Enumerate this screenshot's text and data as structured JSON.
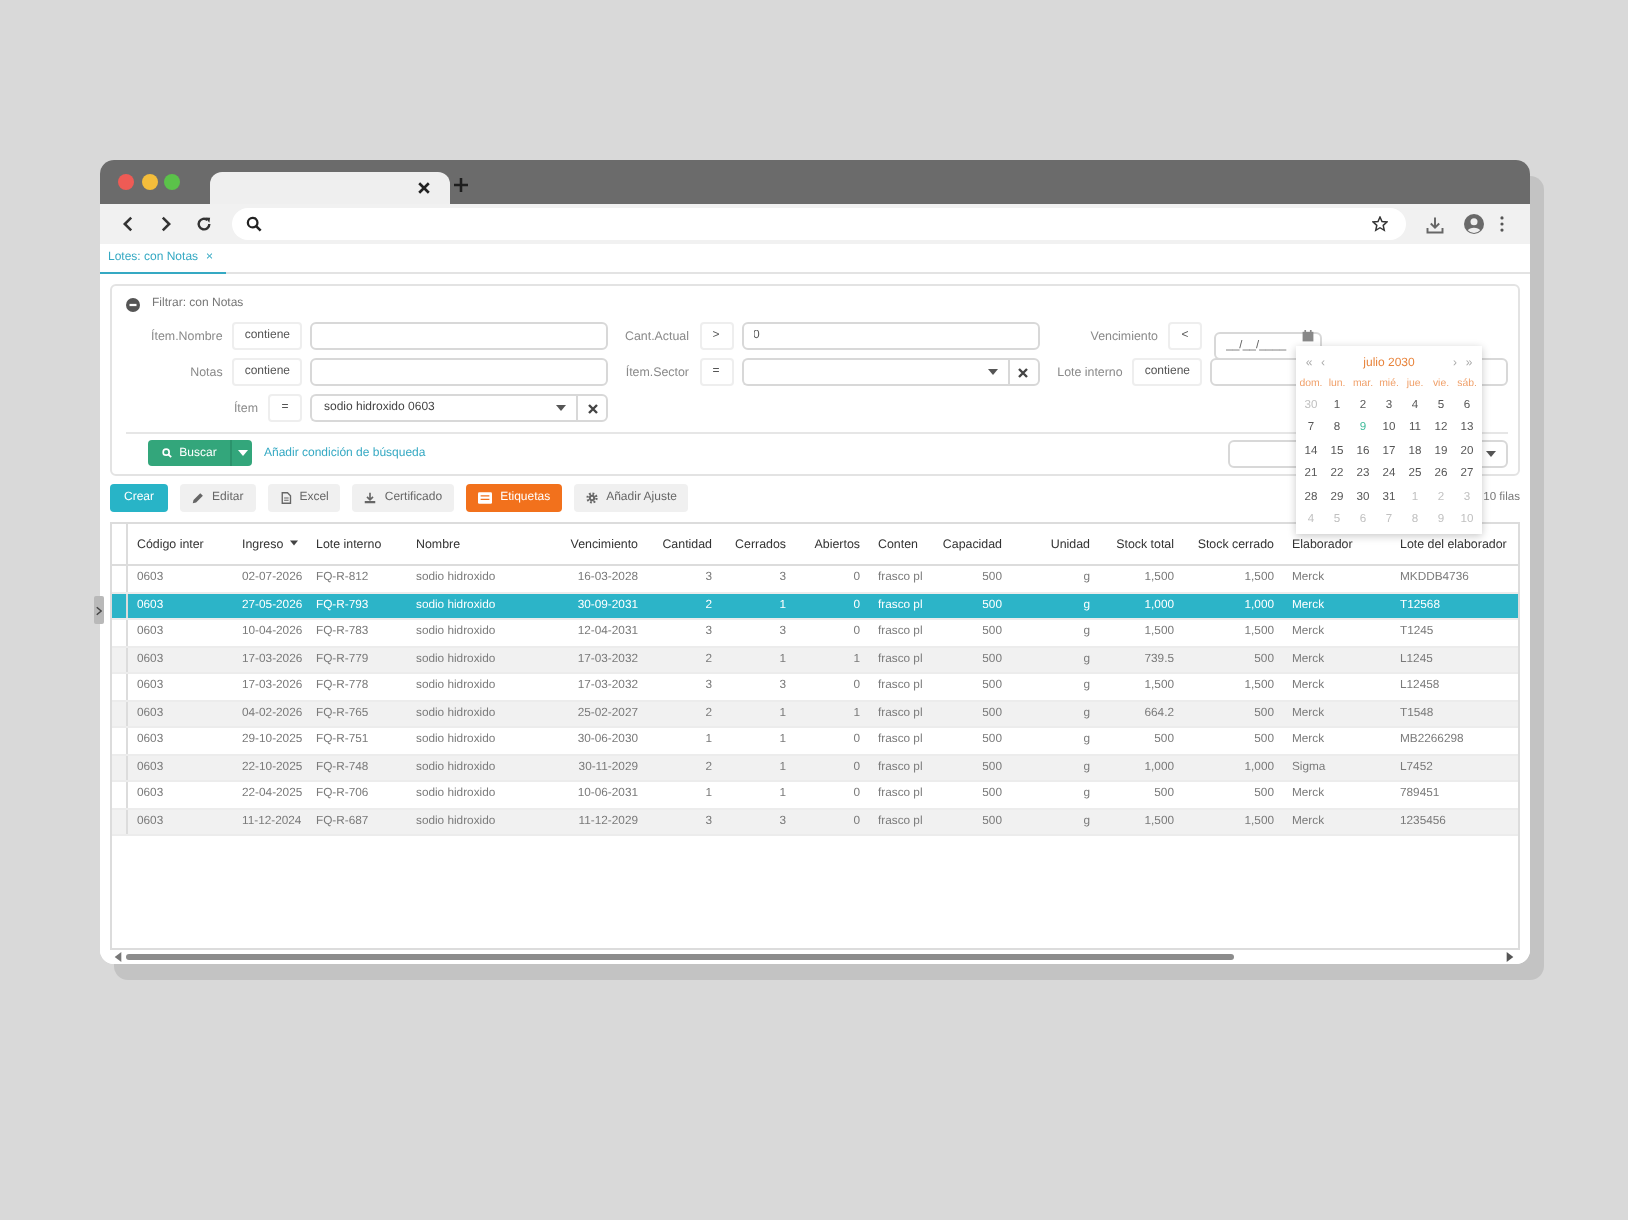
{
  "app_tabs": [
    {
      "label": "Lotes: con Notas",
      "close": "×",
      "selected": true
    }
  ],
  "filter": {
    "title": "Filtrar: con Notas",
    "expanded": true,
    "rows": [
      [
        {
          "label": "Ítem.Nombre",
          "operator": "contiene",
          "kind": "text"
        },
        {
          "label": "Cant.Actual",
          "operator": ">",
          "kind": "text",
          "value": "0"
        },
        {
          "label": "Vencimiento",
          "operator": "<",
          "kind": "date",
          "placeholder": "__/__/____"
        }
      ],
      [
        {
          "label": "Notas",
          "operator": "contiene",
          "kind": "text"
        },
        {
          "label": "Ítem.Sector",
          "operator": "=",
          "kind": "select"
        },
        {
          "label": "Lote interno",
          "operator": "contiene",
          "kind": "text"
        }
      ],
      [
        {
          "label": "Ítem",
          "operator": "=",
          "kind": "select",
          "value": "sodio hidroxido 0603"
        }
      ]
    ],
    "search_button": "Buscar",
    "add_condition": "Añadir condición de búsqueda"
  },
  "actions": {
    "buttons": [
      {
        "label": "Crear",
        "kind": "primary"
      },
      {
        "label": "Editar",
        "kind": "default"
      },
      {
        "label": "Excel",
        "kind": "default"
      },
      {
        "label": "Certificado",
        "kind": "default"
      },
      {
        "label": "Etiquetas",
        "kind": "warning"
      },
      {
        "label": "Añadir Ajuste",
        "kind": "default"
      }
    ],
    "row_count": "10 filas"
  },
  "table": {
    "columns": [
      {
        "label": "Código inter",
        "sorted": false
      },
      {
        "label": "Ingreso",
        "sorted": true
      },
      {
        "label": "Lote interno",
        "sorted": false
      },
      {
        "label": "Nombre",
        "sorted": false
      },
      {
        "label": "Vencimiento",
        "sorted": false
      },
      {
        "label": "Cantidad",
        "sorted": false
      },
      {
        "label": "Cerrados",
        "sorted": false
      },
      {
        "label": "Abiertos",
        "sorted": false
      },
      {
        "label": "Conten",
        "sorted": false
      },
      {
        "label": "Capacidad",
        "sorted": false
      },
      {
        "label": "Unidad",
        "sorted": false
      },
      {
        "label": "Stock total",
        "sorted": false
      },
      {
        "label": "Stock cerrado",
        "sorted": false
      },
      {
        "label": "Elaborador",
        "sorted": false
      },
      {
        "label": "Lote del elaborador",
        "sorted": false
      }
    ],
    "rows": [
      {
        "selected": false,
        "cells": [
          "0603",
          "02-07-2026",
          "FQ-R-812",
          "sodio hidroxido",
          "16-03-2028",
          "3",
          "3",
          "0",
          "frasco pl",
          "500",
          "g",
          "1,500",
          "1,500",
          "Merck",
          "MKDDB4736"
        ]
      },
      {
        "selected": true,
        "cells": [
          "0603",
          "27-05-2026",
          "FQ-R-793",
          "sodio hidroxido",
          "30-09-2031",
          "2",
          "1",
          "0",
          "frasco pl",
          "500",
          "g",
          "1,000",
          "1,000",
          "Merck",
          "T12568"
        ]
      },
      {
        "selected": false,
        "cells": [
          "0603",
          "10-04-2026",
          "FQ-R-783",
          "sodio hidroxido",
          "12-04-2031",
          "3",
          "3",
          "0",
          "frasco pl",
          "500",
          "g",
          "1,500",
          "1,500",
          "Merck",
          "T1245"
        ]
      },
      {
        "selected": false,
        "cells": [
          "0603",
          "17-03-2026",
          "FQ-R-779",
          "sodio hidroxido",
          "17-03-2032",
          "2",
          "1",
          "1",
          "frasco pl",
          "500",
          "g",
          "739.5",
          "500",
          "Merck",
          "L1245"
        ]
      },
      {
        "selected": false,
        "cells": [
          "0603",
          "17-03-2026",
          "FQ-R-778",
          "sodio hidroxido",
          "17-03-2032",
          "3",
          "3",
          "0",
          "frasco pl",
          "500",
          "g",
          "1,500",
          "1,500",
          "Merck",
          "L12458"
        ]
      },
      {
        "selected": false,
        "cells": [
          "0603",
          "04-02-2026",
          "FQ-R-765",
          "sodio hidroxido",
          "25-02-2027",
          "2",
          "1",
          "1",
          "frasco pl",
          "500",
          "g",
          "664.2",
          "500",
          "Merck",
          "T1548"
        ]
      },
      {
        "selected": false,
        "cells": [
          "0603",
          "29-10-2025",
          "FQ-R-751",
          "sodio hidroxido",
          "30-06-2030",
          "1",
          "1",
          "0",
          "frasco pl",
          "500",
          "g",
          "500",
          "500",
          "Merck",
          "MB2266298"
        ]
      },
      {
        "selected": false,
        "cells": [
          "0603",
          "22-10-2025",
          "FQ-R-748",
          "sodio hidroxido",
          "30-11-2029",
          "2",
          "1",
          "0",
          "frasco pl",
          "500",
          "g",
          "1,000",
          "1,000",
          "Sigma",
          "L7452"
        ]
      },
      {
        "selected": false,
        "cells": [
          "0603",
          "22-04-2025",
          "FQ-R-706",
          "sodio hidroxido",
          "10-06-2031",
          "1",
          "1",
          "0",
          "frasco pl",
          "500",
          "g",
          "500",
          "500",
          "Merck",
          "789451"
        ]
      },
      {
        "selected": false,
        "cells": [
          "0603",
          "11-12-2024",
          "FQ-R-687",
          "sodio hidroxido",
          "11-12-2029",
          "3",
          "3",
          "0",
          "frasco pl",
          "500",
          "g",
          "1,500",
          "1,500",
          "Merck",
          "1235456"
        ]
      }
    ]
  },
  "datepicker": {
    "title": "julio 2030",
    "nav": [
      "«",
      "‹",
      "›",
      "»"
    ],
    "weekdays": [
      "dom.",
      "lun.",
      "mar.",
      "mié.",
      "jue.",
      "vie.",
      "sáb."
    ],
    "weeks": [
      [
        {
          "label": "30",
          "kind": "outside"
        },
        {
          "label": "1",
          "kind": "current"
        },
        {
          "label": "2",
          "kind": "current"
        },
        {
          "label": "3",
          "kind": "current"
        },
        {
          "label": "4",
          "kind": "current"
        },
        {
          "label": "5",
          "kind": "current"
        },
        {
          "label": "6",
          "kind": "current"
        }
      ],
      [
        {
          "label": "7",
          "kind": "current"
        },
        {
          "label": "8",
          "kind": "current"
        },
        {
          "label": "9",
          "kind": "today"
        },
        {
          "label": "10",
          "kind": "current"
        },
        {
          "label": "11",
          "kind": "current"
        },
        {
          "label": "12",
          "kind": "current"
        },
        {
          "label": "13",
          "kind": "current"
        }
      ],
      [
        {
          "label": "14",
          "kind": "current"
        },
        {
          "label": "15",
          "kind": "current"
        },
        {
          "label": "16",
          "kind": "current"
        },
        {
          "label": "17",
          "kind": "current"
        },
        {
          "label": "18",
          "kind": "current"
        },
        {
          "label": "19",
          "kind": "current"
        },
        {
          "label": "20",
          "kind": "current"
        }
      ],
      [
        {
          "label": "21",
          "kind": "current"
        },
        {
          "label": "22",
          "kind": "current"
        },
        {
          "label": "23",
          "kind": "current"
        },
        {
          "label": "24",
          "kind": "current"
        },
        {
          "label": "25",
          "kind": "current"
        },
        {
          "label": "26",
          "kind": "current"
        },
        {
          "label": "27",
          "kind": "current"
        }
      ],
      [
        {
          "label": "28",
          "kind": "current"
        },
        {
          "label": "29",
          "kind": "current"
        },
        {
          "label": "30",
          "kind": "current"
        },
        {
          "label": "31",
          "kind": "current"
        },
        {
          "label": "1",
          "kind": "outside"
        },
        {
          "label": "2",
          "kind": "outside"
        },
        {
          "label": "3",
          "kind": "outside"
        }
      ],
      [
        {
          "label": "4",
          "kind": "outside"
        },
        {
          "label": "5",
          "kind": "outside"
        },
        {
          "label": "6",
          "kind": "outside"
        },
        {
          "label": "7",
          "kind": "outside"
        },
        {
          "label": "8",
          "kind": "outside"
        },
        {
          "label": "9",
          "kind": "outside"
        },
        {
          "label": "10",
          "kind": "outside"
        }
      ]
    ]
  }
}
